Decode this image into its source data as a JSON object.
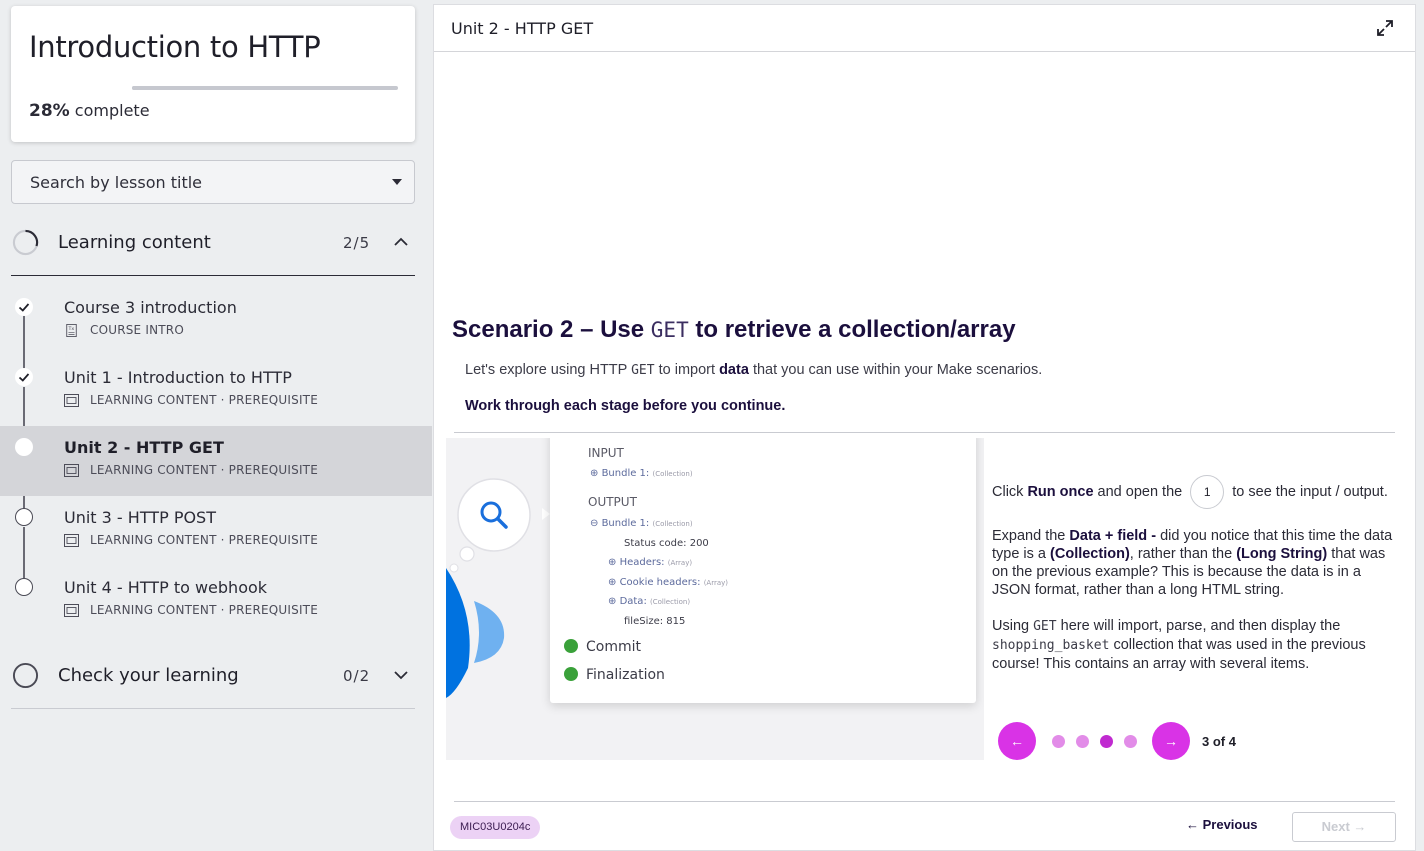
{
  "course": {
    "title": "Introduction to HTTP",
    "progress_percent": 28,
    "progress_pct_label": "28%",
    "progress_suffix": "complete"
  },
  "search": {
    "placeholder": "Search by lesson title"
  },
  "sections": [
    {
      "title": "Learning content",
      "count": "2/5",
      "expanded": true,
      "lessons": [
        {
          "title": "Course 3 introduction",
          "meta": "COURSE INTRO",
          "status": "complete",
          "icon": "text-doc-icon"
        },
        {
          "title": "Unit 1 - Introduction to HTTP",
          "meta": "LEARNING CONTENT · PREREQUISITE",
          "status": "complete",
          "icon": "media-icon"
        },
        {
          "title": "Unit 2 - HTTP GET",
          "meta": "LEARNING CONTENT · PREREQUISITE",
          "status": "current",
          "icon": "media-icon"
        },
        {
          "title": "Unit 3 - HTTP POST",
          "meta": "LEARNING CONTENT · PREREQUISITE",
          "status": "not-started",
          "icon": "media-icon"
        },
        {
          "title": "Unit 4 - HTTP to webhook",
          "meta": "LEARNING CONTENT · PREREQUISITE",
          "status": "not-started",
          "icon": "media-icon"
        }
      ]
    },
    {
      "title": "Check your learning",
      "count": "0/2",
      "expanded": false
    }
  ],
  "main": {
    "header_title": "Unit 2 - HTTP GET",
    "scenario_title_pre": "Scenario 2 – Use",
    "scenario_title_code": "GET",
    "scenario_title_post": "to retrieve a collection/array",
    "intro_pre": "Let's explore using HTTP",
    "intro_code": "GET",
    "intro_mid": "to import",
    "intro_bold": "data",
    "intro_post": "that you can use within your Make scenarios.",
    "work_line": "Work through each stage before you continue.",
    "figure": {
      "input_label": "INPUT",
      "bundle_in": "Bundle 1:",
      "collection_tag": "(Collection)",
      "output_label": "OUTPUT",
      "bundle_out": "Bundle 1:",
      "status_line": "Status code: 200",
      "headers": "Headers:",
      "array_tag": "(Array)",
      "cookie_headers": "Cookie headers:",
      "data": "Data:",
      "filesize": "fileSize: 815",
      "commit": "Commit",
      "finalization": "Finalization"
    },
    "step": {
      "p1_pre": "Click",
      "p1_bold": "Run once",
      "p1_mid": "and open the",
      "p1_badge": "1",
      "p1_post": "to see the input / output.",
      "p2_pre": "Expand the",
      "p2_bold1": "Data + field -",
      "p2_mid1": " did you notice that this time the data type is a",
      "p2_bold2": "(Collection)",
      "p2_mid2": ", rather than the",
      "p2_bold3": "(Long String)",
      "p2_post": "that was on the previous example? This is because the data is in a JSON format, rather than a long HTML string.",
      "p3_pre": "Using",
      "p3_code1": "GET",
      "p3_mid": "here will import, parse, and then display the",
      "p3_code2": "shopping_basket",
      "p3_post": "collection that was used in the previous course! This contains an array with several items."
    },
    "carousel": {
      "prev": "←",
      "next": "→",
      "current": 3,
      "total": 4,
      "label": "3 of 4"
    },
    "ref_code": "MIC03U0204c",
    "prev_label": "← Previous",
    "next_label": "Next →"
  },
  "colors": {
    "accent": "#d933e6",
    "accent_dark": "#c02ad0",
    "title": "#1b0f3d"
  }
}
